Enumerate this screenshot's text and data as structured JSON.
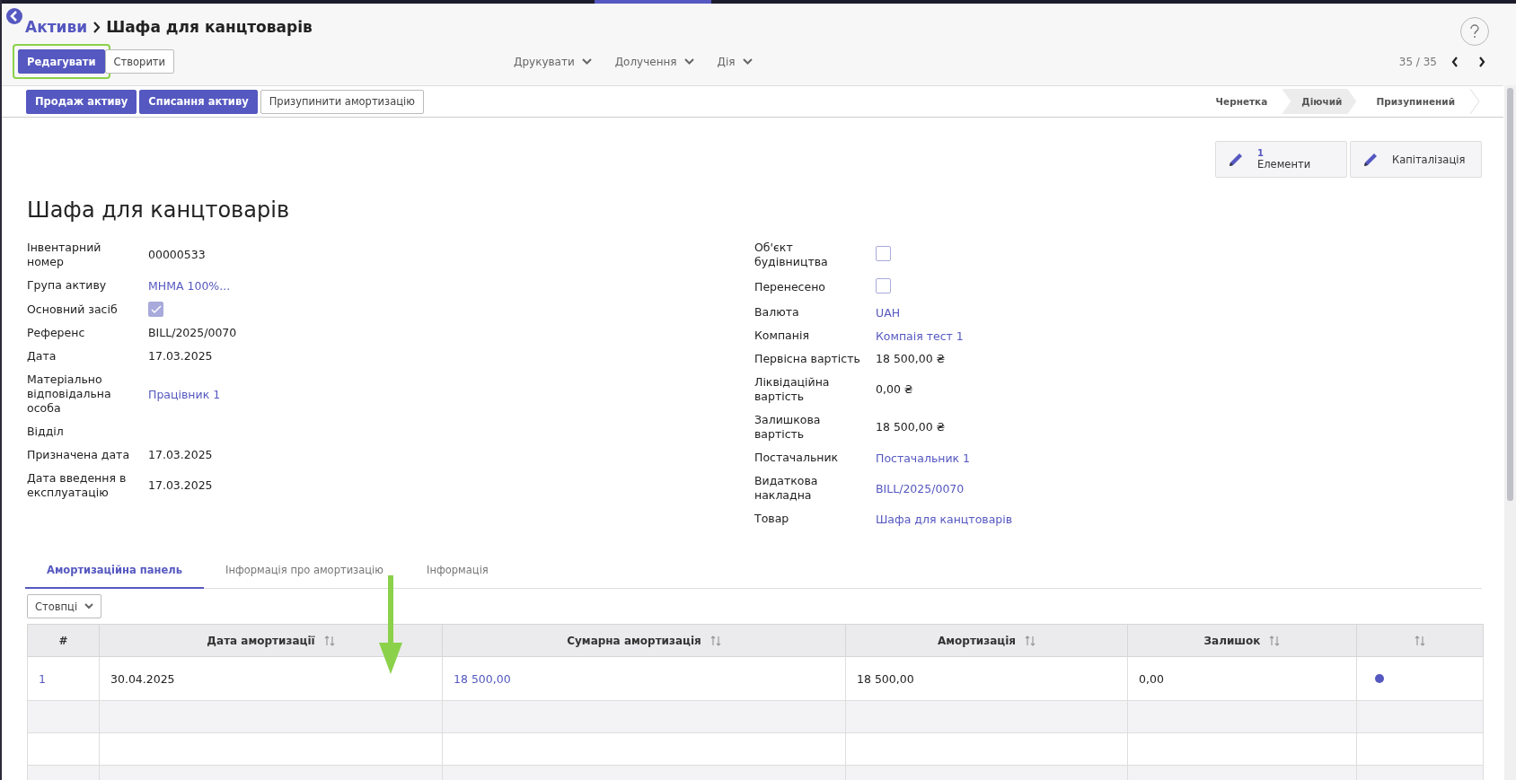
{
  "breadcrumb": {
    "parent": "Активи",
    "current": "Шафа для канцтоварів"
  },
  "toolbar": {
    "buttons": [
      {
        "label": "Редагувати",
        "kind": "primary",
        "highlighted": true
      },
      {
        "label": "Створити",
        "kind": "secondary",
        "highlighted": false
      }
    ],
    "menus": [
      "Друкувати",
      "Долучення",
      "Дія"
    ],
    "pager": "35 / 35"
  },
  "actions": [
    {
      "label": "Продаж активу",
      "kind": "primary"
    },
    {
      "label": "Списання активу",
      "kind": "primary"
    },
    {
      "label": "Призупинити амортизацію",
      "kind": "secondary"
    }
  ],
  "statusbar": [
    {
      "label": "Чернетка",
      "selected": false
    },
    {
      "label": "Діючий",
      "selected": true
    },
    {
      "label": "Призупинений",
      "selected": false
    }
  ],
  "smart_buttons": [
    {
      "count": "1",
      "label": "Елементи"
    },
    {
      "label": "Капіталізація"
    }
  ],
  "title": "Шафа для канцтоварів",
  "left_fields": [
    {
      "label": "Інвентарний номер",
      "kind": "text",
      "value": "00000533"
    },
    {
      "label": "Група активу",
      "kind": "link",
      "value": "МНМА 100%..."
    },
    {
      "label": "Основний засіб",
      "kind": "checkbox",
      "checked": true
    },
    {
      "label": "Референс",
      "kind": "text",
      "value": "BILL/2025/0070"
    },
    {
      "label": "Дата",
      "kind": "text",
      "value": "17.03.2025"
    },
    {
      "label": "Матеріально відповідальна особа",
      "kind": "link",
      "value": "Працівник 1"
    },
    {
      "label": "Відділ",
      "kind": "text"
    },
    {
      "label": "Призначена дата",
      "kind": "text",
      "value": "17.03.2025"
    },
    {
      "label": "Дата введення в експлуатацію",
      "kind": "text",
      "value": "17.03.2025"
    }
  ],
  "right_fields": [
    {
      "label": "Об'єкт будівництва",
      "kind": "checkbox",
      "checked": false
    },
    {
      "label": "Перенесено",
      "kind": "checkbox",
      "checked": false
    },
    {
      "label": "Валюта",
      "kind": "link",
      "value": "UAH"
    },
    {
      "label": "Компанія",
      "kind": "link",
      "value": "Компаія тест 1"
    },
    {
      "label": "Первісна вартість",
      "kind": "text",
      "value": "18 500,00 ₴"
    },
    {
      "label": "Ліквідаційна вартість",
      "kind": "text",
      "value": "0,00 ₴"
    },
    {
      "label": "Залишкова вартість",
      "kind": "text",
      "value": "18 500,00 ₴"
    },
    {
      "label": "Постачальник",
      "kind": "link",
      "value": "Постачальник 1"
    },
    {
      "label": "Видаткова накладна",
      "kind": "link",
      "value": "BILL/2025/0070"
    },
    {
      "label": "Товар",
      "kind": "link",
      "value": "Шафа для канцтоварів"
    }
  ],
  "tabs": [
    {
      "label": "Амортизаційна панель",
      "selected": true
    },
    {
      "label": "Інформація про амортизацію",
      "selected": false
    },
    {
      "label": "Інформація",
      "selected": false
    }
  ],
  "columns_button": "Стовпці",
  "table": {
    "columns": [
      {
        "label": "#",
        "sortable": false
      },
      {
        "label": "Дата амортизації",
        "sortable": true
      },
      {
        "label": "Сумарна амортизація",
        "sortable": true
      },
      {
        "label": "Амортизація",
        "sortable": true
      },
      {
        "label": "Залишок",
        "sortable": true
      },
      {
        "sortable": true
      }
    ],
    "rows": [
      {
        "cells": [
          "1",
          "30.04.2025",
          "18 500,00",
          "18 500,00",
          "0,00"
        ],
        "color": "#5558c0"
      }
    ]
  }
}
